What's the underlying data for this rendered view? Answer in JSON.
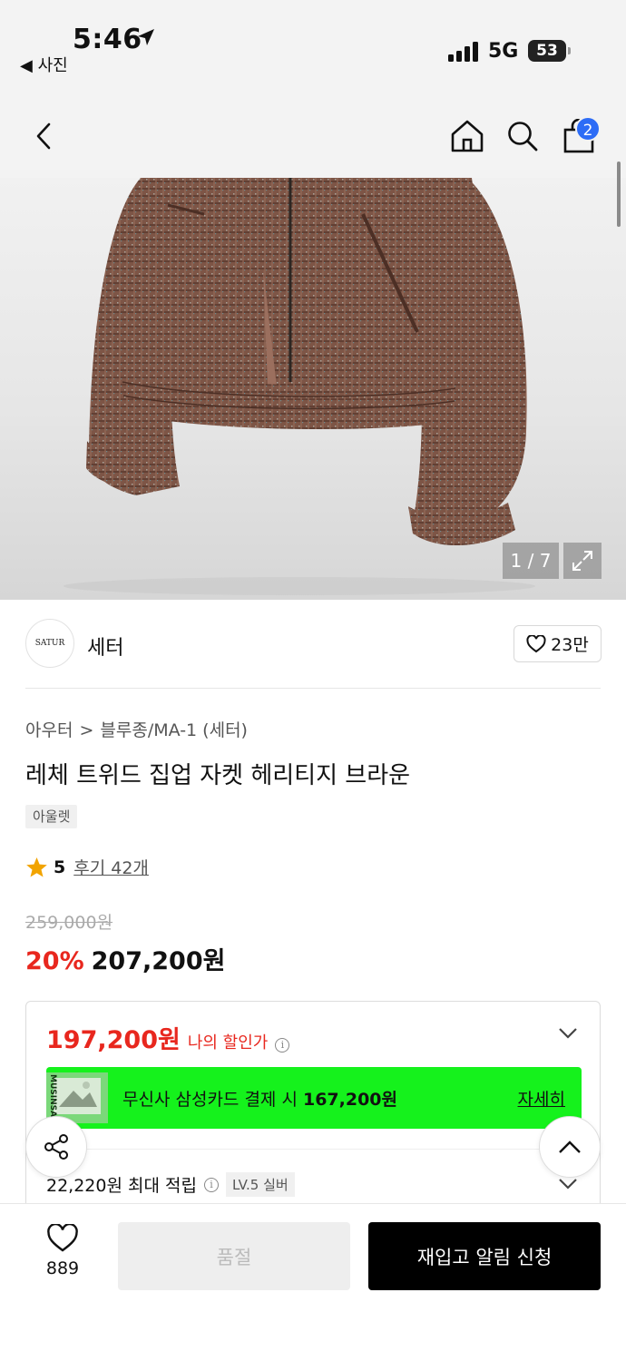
{
  "status_bar": {
    "time": "5:46",
    "back_app": "◀ 사진",
    "network": "5G",
    "battery": "53"
  },
  "header": {
    "cart_count": "2"
  },
  "gallery": {
    "counter": "1 / 7"
  },
  "brand": {
    "logo_text": "SATUR",
    "name": "세터",
    "likes": "23만"
  },
  "breadcrumb": {
    "category": "아우터",
    "separator": ">",
    "subcategory": "블루종/MA-1 (세터)"
  },
  "product": {
    "title": "레체 트위드 집업 자켓 헤리티지 브라운",
    "tag": "아울렛",
    "rating": "5",
    "reviews": "후기 42개",
    "original_price": "259,000원",
    "discount_rate": "20%",
    "sale_price": "207,200원"
  },
  "benefit": {
    "my_price": "197,200원",
    "my_price_label": "나의 할인가",
    "card_text": "무신사 삼성카드 결제 시",
    "card_price": "167,200원",
    "card_link": "자세히",
    "card_thumb_text": "MUSINSA",
    "points": "22,220원 최대 적립",
    "level": "LV.5 실버"
  },
  "bottom_bar": {
    "wish_count": "889",
    "soldout_label": "품절",
    "restock_label": "재입고 알림 신청"
  },
  "colors": {
    "accent_red": "#e8271e",
    "promo_green": "#15f21c",
    "badge_blue": "#2d6cf6"
  }
}
